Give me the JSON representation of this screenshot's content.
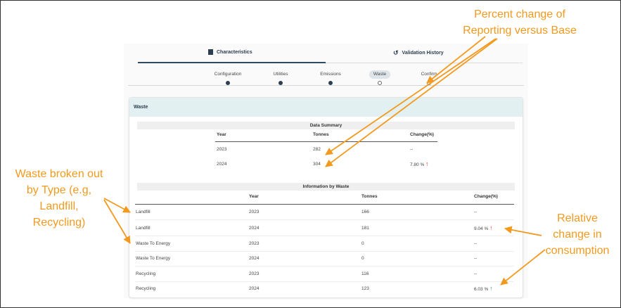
{
  "tabs": {
    "characteristics": "Characteristics",
    "validation_history": "Validation History"
  },
  "steps": [
    {
      "label": "Configuration",
      "state": "done"
    },
    {
      "label": "Utilities",
      "state": "done"
    },
    {
      "label": "Emissions",
      "state": "done"
    },
    {
      "label": "Waste",
      "state": "active"
    },
    {
      "label": "Confirm",
      "state": "pending"
    }
  ],
  "card": {
    "title": "Waste"
  },
  "summary": {
    "title": "Data Summary",
    "headers": {
      "year": "Year",
      "tonnes": "Tonnes",
      "change": "Change(%)"
    },
    "rows": [
      {
        "year": "2023",
        "tonnes": "282",
        "change": "--",
        "trend": ""
      },
      {
        "year": "2024",
        "tonnes": "304",
        "change": "7.80 %",
        "trend": "up"
      }
    ]
  },
  "by_waste": {
    "title": "Information by Waste",
    "headers": {
      "type": "",
      "year": "Year",
      "tonnes": "Tonnes",
      "change": "Change(%)"
    },
    "rows": [
      {
        "type": "Landfill",
        "year": "2023",
        "tonnes": "166",
        "change": "--",
        "trend": ""
      },
      {
        "type": "Landfill",
        "year": "2024",
        "tonnes": "181",
        "change": "9.04 %",
        "trend": "up"
      },
      {
        "type": "Waste To Energy",
        "year": "2023",
        "tonnes": "0",
        "change": "--",
        "trend": ""
      },
      {
        "type": "Waste To Energy",
        "year": "2024",
        "tonnes": "0",
        "change": "--",
        "trend": ""
      },
      {
        "type": "Recycling",
        "year": "2023",
        "tonnes": "116",
        "change": "--",
        "trend": ""
      },
      {
        "type": "Recycling",
        "year": "2024",
        "tonnes": "123",
        "change": "6.03 %",
        "trend": "up-good"
      }
    ]
  },
  "annotations": {
    "percent_change_line1": "Percent change of",
    "percent_change_line2": "Reporting versus Base",
    "waste_type_line1": "Waste broken out",
    "waste_type_line2": "by Type (e.g,",
    "waste_type_line3": "Landfill,",
    "waste_type_line4": "Recycling)",
    "relative_line1": "Relative",
    "relative_line2": "change in",
    "relative_line3": "consumption"
  },
  "icons": {
    "characteristics": "building-icon",
    "validation_history": "history-icon",
    "trend_up_bad": "arrow-up-red-icon",
    "trend_up_good": "arrow-up-green-icon"
  },
  "colors": {
    "annotation": "#f29a1f",
    "header_bg": "#e3f0f2",
    "up_bad": "#e53935",
    "up_good": "#2e9e44",
    "primary": "#2c3e50"
  }
}
